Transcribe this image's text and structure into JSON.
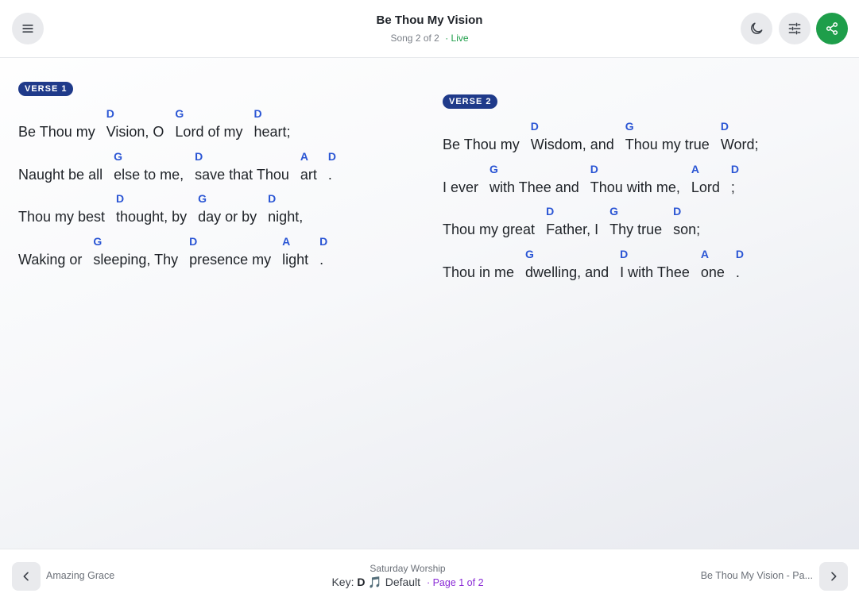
{
  "header": {
    "title": "Be Thou My Vision",
    "subtitle": "Song 2 of 2",
    "status": "· Live",
    "icons": {
      "menu": "menu-icon",
      "theme": "moon-icon",
      "settings": "sliders-icon",
      "share": "share-icon"
    },
    "colors": {
      "share_bg": "#1e9e4a",
      "live": "#1e9e4a"
    }
  },
  "verses": [
    {
      "label": "VERSE 1",
      "lines": [
        {
          "segments": [
            {
              "chord": "",
              "text": "Be Thou my"
            },
            {
              "chord": "D",
              "text": "Vision, O"
            },
            {
              "chord": "G",
              "text": "Lord of my"
            },
            {
              "chord": "D",
              "text": "heart;"
            }
          ]
        },
        {
          "segments": [
            {
              "chord": "",
              "text": "Naught be all"
            },
            {
              "chord": "G",
              "text": "else to me,"
            },
            {
              "chord": "D",
              "text": "save that Thou"
            },
            {
              "chord": "A",
              "text": "art"
            },
            {
              "chord": "D",
              "text": "."
            }
          ]
        },
        {
          "segments": [
            {
              "chord": "",
              "text": "Thou my best"
            },
            {
              "chord": "D",
              "text": "thought, by"
            },
            {
              "chord": "G",
              "text": "day or by"
            },
            {
              "chord": "D",
              "text": "night,"
            }
          ]
        },
        {
          "segments": [
            {
              "chord": "",
              "text": "Waking or"
            },
            {
              "chord": "G",
              "text": "sleeping, Thy"
            },
            {
              "chord": "D",
              "text": "presence my"
            },
            {
              "chord": "A",
              "text": "light"
            },
            {
              "chord": "D",
              "text": "."
            }
          ]
        }
      ]
    },
    {
      "label": "VERSE 2",
      "lines": [
        {
          "segments": [
            {
              "chord": "",
              "text": "Be Thou my"
            },
            {
              "chord": "D",
              "text": "Wisdom, and"
            },
            {
              "chord": "G",
              "text": "Thou my true"
            },
            {
              "chord": "D",
              "text": "Word;"
            }
          ]
        },
        {
          "segments": [
            {
              "chord": "",
              "text": "I ever"
            },
            {
              "chord": "G",
              "text": "with Thee and"
            },
            {
              "chord": "D",
              "text": "Thou with me,"
            },
            {
              "chord": "A",
              "text": "Lord"
            },
            {
              "chord": "D",
              "text": ";"
            }
          ]
        },
        {
          "segments": [
            {
              "chord": "",
              "text": "Thou my great"
            },
            {
              "chord": "D",
              "text": "Father, I"
            },
            {
              "chord": "G",
              "text": "Thy true"
            },
            {
              "chord": "D",
              "text": "son;"
            }
          ]
        },
        {
          "segments": [
            {
              "chord": "",
              "text": "Thou in me"
            },
            {
              "chord": "G",
              "text": "dwelling, and"
            },
            {
              "chord": "D",
              "text": "I with Thee"
            },
            {
              "chord": "A",
              "text": "one"
            },
            {
              "chord": "D",
              "text": "."
            }
          ]
        }
      ]
    }
  ],
  "footer": {
    "prev_label": "Amazing Grace",
    "next_label": "Be Thou My Vision - Pa...",
    "set_name": "Saturday Worship",
    "key_prefix": "Key:",
    "key": "D",
    "key_icon": "music-note-icon",
    "key_icon_glyph": "🎵",
    "arrangement": "Default",
    "page": "· Page 1 of 2",
    "colors": {
      "page": "#8a2bd6",
      "chord": "#2a55d4",
      "badge": "#1f3a8a"
    }
  }
}
